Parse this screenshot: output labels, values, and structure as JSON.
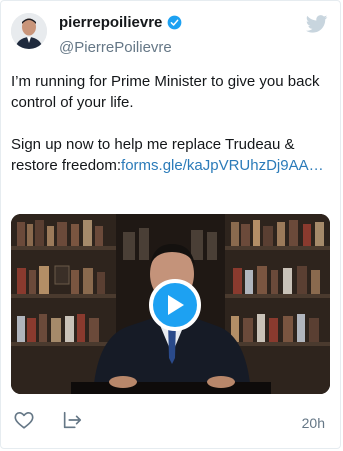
{
  "user": {
    "display_name": "pierrepoilievre",
    "handle": "@PierrePoilievre",
    "verified": true
  },
  "tweet": {
    "text_line1": "I’m running for Prime Minister to give you back control of your life.",
    "text_line2": "Sign up now to help me replace Trudeau & restore freedom:",
    "link": "forms.gle/kaJpVRUhzDj9AA…"
  },
  "media": {
    "type": "video",
    "play_icon": "play-icon"
  },
  "actions": {
    "like_icon": "heart-icon",
    "share_icon": "share-icon",
    "timestamp": "20h"
  },
  "colors": {
    "brand_blue": "#1da1f2",
    "link": "#2b7bb9",
    "secondary_text": "#657786"
  }
}
